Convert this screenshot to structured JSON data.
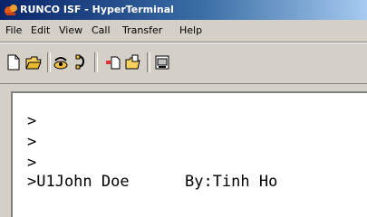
{
  "window": {
    "title": "RUNCO ISF - HyperTerminal"
  },
  "menubar": {
    "items": [
      "File",
      "Edit",
      "View",
      "Call",
      "Transfer",
      "Help"
    ]
  },
  "toolbar": {
    "buttons": [
      {
        "icon": "new-icon"
      },
      {
        "icon": "open-icon"
      },
      {
        "icon": "connect-icon"
      },
      {
        "icon": "disconnect-icon"
      },
      {
        "icon": "send-icon"
      },
      {
        "icon": "receive-icon"
      },
      {
        "icon": "properties-icon"
      }
    ]
  },
  "terminal": {
    "lines": [
      ">",
      ">",
      ">",
      ">U1John Doe      By:Tinh Ho"
    ]
  },
  "colors": {
    "title_start": "#0a246a",
    "title_end": "#a6caf0",
    "chrome": "#d4d0c8"
  }
}
